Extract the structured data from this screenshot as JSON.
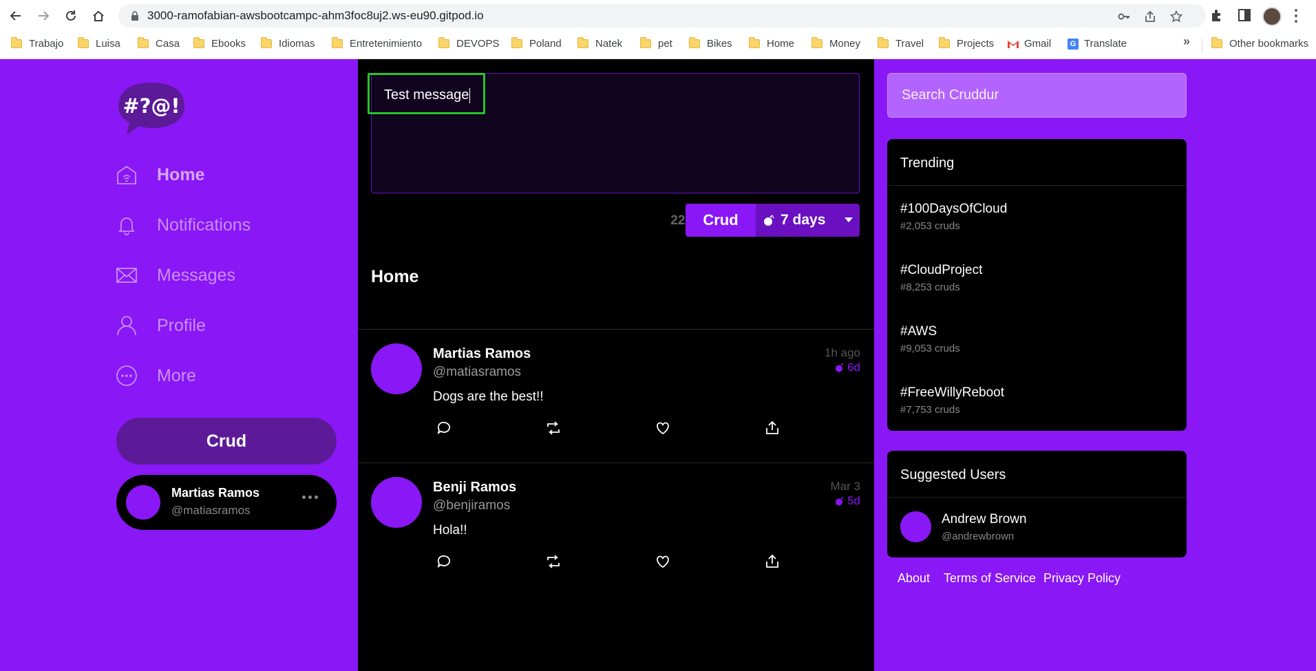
{
  "browser": {
    "url": "3000-ramofabian-awsbootcampc-ahm3foc8uj2.ws-eu90.gitpod.io",
    "bookmarks": [
      "Trabajo",
      "Luisa",
      "Casa",
      "Ebooks",
      "Idiomas",
      "Entretenimiento",
      "DEVOPS",
      "Poland",
      "Natek",
      "pet",
      "Bikes",
      "Home",
      "Money",
      "Travel",
      "Projects",
      "Gmail",
      "Translate"
    ],
    "more_bookmarks": "»",
    "other_bookmarks": "Other bookmarks"
  },
  "sidebar": {
    "logo_text": "#?@!",
    "nav": [
      "Home",
      "Notifications",
      "Messages",
      "Profile",
      "More"
    ],
    "active": "Home",
    "crud_button": "Crud",
    "profile": {
      "name": "Martias Ramos",
      "handle": "@matiasramos"
    }
  },
  "compose": {
    "text": "Test message",
    "char_count": "228",
    "submit_label": "Crud",
    "expiry": "7 days"
  },
  "feed": {
    "title": "Home",
    "posts": [
      {
        "name": "Martias Ramos",
        "handle": "@matiasramos",
        "message": "Dogs are the best!!",
        "time": "1h ago",
        "expires": "6d"
      },
      {
        "name": "Benji Ramos",
        "handle": "@benjiramos",
        "message": "Hola!!",
        "time": "Mar 3",
        "expires": "5d"
      }
    ]
  },
  "search": {
    "placeholder": "Search Cruddur"
  },
  "trending": {
    "title": "Trending",
    "items": [
      {
        "tag": "#100DaysOfCloud",
        "count": "#2,053 cruds"
      },
      {
        "tag": "#CloudProject",
        "count": "#8,253 cruds"
      },
      {
        "tag": "#AWS",
        "count": "#9,053 cruds"
      },
      {
        "tag": "#FreeWillyReboot",
        "count": "#7,753 cruds"
      }
    ]
  },
  "suggested": {
    "title": "Suggested Users",
    "users": [
      {
        "name": "Andrew Brown",
        "handle": "@andrewbrown"
      }
    ]
  },
  "footer": [
    "About",
    "Terms of Service",
    "Privacy Policy"
  ],
  "colors": {
    "brand": "#8a17f5",
    "brand_dark": "#5c1a99",
    "feed_bg": "#000000",
    "focus": "#28c528"
  }
}
